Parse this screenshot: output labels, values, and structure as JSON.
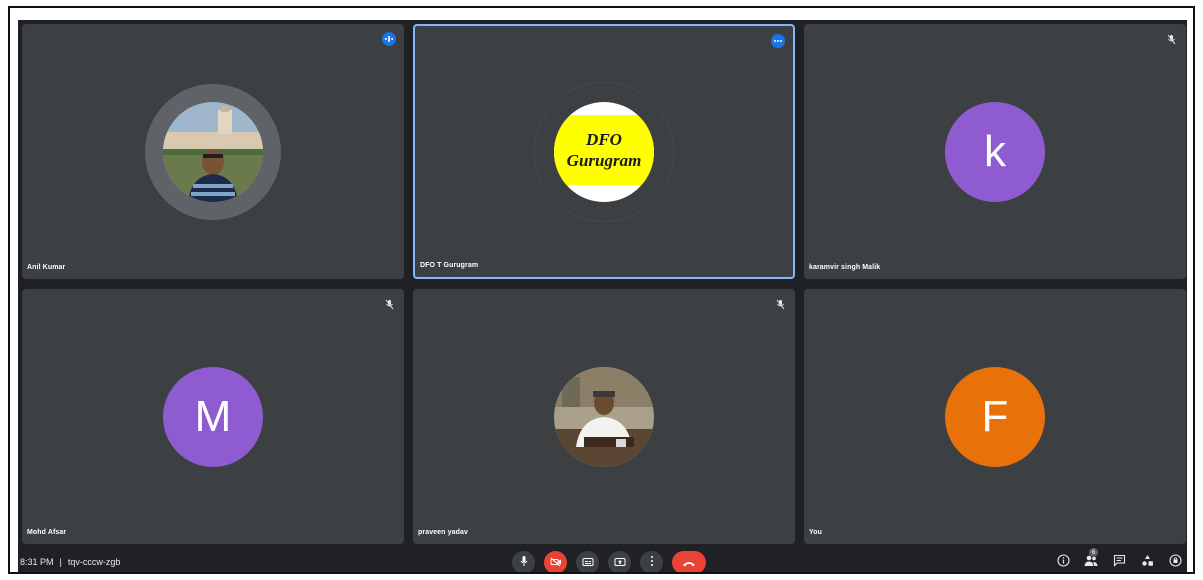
{
  "meeting": {
    "time": "8:31 PM",
    "separator": "|",
    "code": "tqv-cccw-zgb"
  },
  "participants": [
    {
      "name": "Anil Kumar",
      "avatar": "photo-campus",
      "indicator": "speaking-icon"
    },
    {
      "name": "DFO T Gurugram",
      "avatar": "dfo-logo",
      "indicator": "more-options-icon",
      "pinned_active": true
    },
    {
      "name": "karamvir singh Malik",
      "avatar": "letter",
      "letter": "k",
      "color": "#8e5cd0",
      "indicator": "mic-off-icon"
    },
    {
      "name": "Mohd Afsar",
      "avatar": "letter",
      "letter": "M",
      "color": "#8e5cd0",
      "indicator": "mic-off-icon"
    },
    {
      "name": "praveen yadav",
      "avatar": "photo-office",
      "indicator": "mic-off-icon"
    },
    {
      "name": "You",
      "avatar": "letter",
      "letter": "F",
      "color": "#e8710a",
      "indicator": "none"
    }
  ],
  "dfo_logo": {
    "line1": "DFO",
    "line2": "Gurugram"
  },
  "controls": [
    "mic-icon",
    "camera-off-icon",
    "captions-icon",
    "present-icon",
    "more-vert-icon",
    "end-call-icon"
  ],
  "right_toolbar": {
    "people_count": "6",
    "icons": [
      "info-icon",
      "people-icon",
      "chat-icon",
      "activities-icon",
      "host-controls-icon"
    ]
  },
  "colors": {
    "background": "#202124",
    "tile": "#3c4043",
    "active_border": "#8ab4f8",
    "accent_blue": "#1a73e8",
    "red": "#ea4335"
  }
}
